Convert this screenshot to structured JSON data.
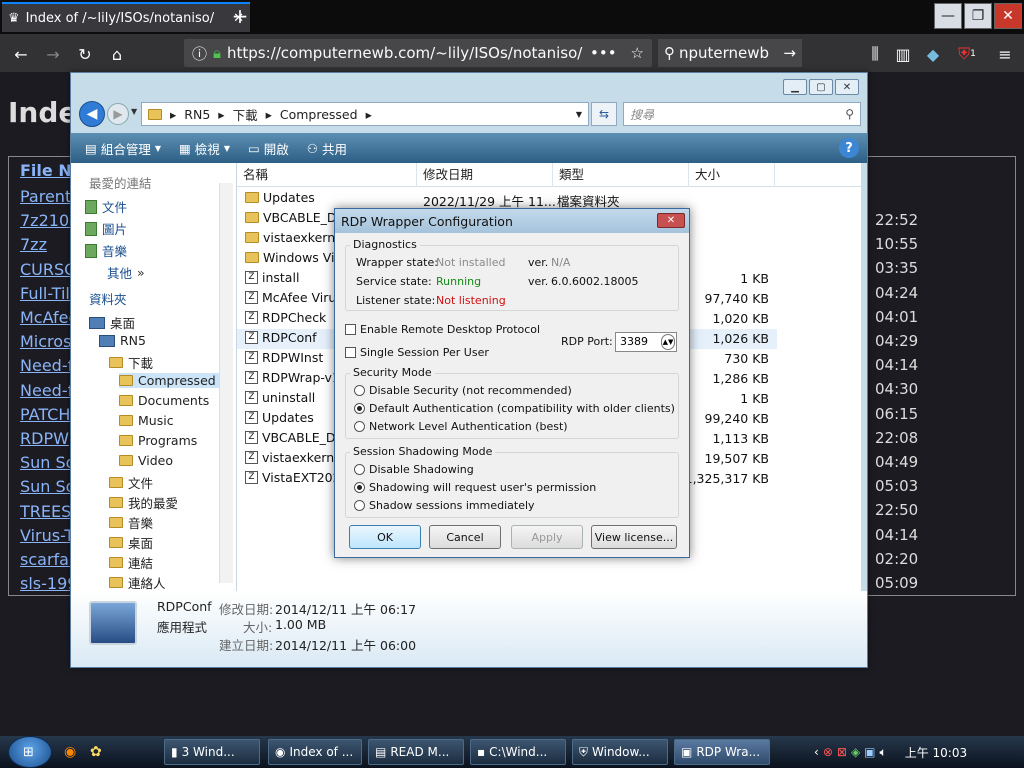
{
  "browser": {
    "tab_title": "Index of /~lily/ISOs/notaniso/",
    "url": "https://computernewb.com/~lily/ISOs/notaniso/",
    "search_text": "nputernewb",
    "new_tab": "+",
    "badge_count": "1"
  },
  "page": {
    "heading": "Index",
    "header_col": "File Na",
    "links": [
      "Parent",
      "7z2104",
      "7zz",
      "CURSO",
      "Full-Tilt",
      "McAfee",
      "Microso",
      "Need-fo",
      "Need-fo",
      "PATCH",
      "RDPW",
      "Sun So",
      "Sun So",
      "TREES",
      "Virus-T",
      "scarfac",
      "sls-199"
    ],
    "times": [
      "22:52",
      "10:55",
      "03:35",
      "04:24",
      "04:01",
      "04:29",
      "04:14",
      "04:30",
      "06:15",
      "22:08",
      "04:49",
      "05:03",
      "22:50",
      "04:14",
      "02:20",
      "05:09"
    ]
  },
  "explorer": {
    "path": [
      "RN5",
      "下載",
      "Compressed"
    ],
    "search_placeholder": "搜尋",
    "toolbar": {
      "organize": "組合管理",
      "view": "檢視",
      "open": "開啟",
      "share": "共用"
    },
    "nav": {
      "favorites_header": "最愛的連結",
      "favorites": [
        "文件",
        "圖片",
        "音樂"
      ],
      "more": "其他",
      "folders_header": "資料夾",
      "tree": [
        "桌面",
        "RN5",
        "下載",
        "Compressed",
        "Documents",
        "Music",
        "Programs",
        "Video",
        "文件",
        "我的最愛",
        "音樂",
        "桌面",
        "連結",
        "連絡人"
      ]
    },
    "columns": {
      "name": "名稱",
      "date": "修改日期",
      "type": "類型",
      "size": "大小"
    },
    "rows": [
      {
        "name": "Updates",
        "date": "2022/11/29 上午 11...",
        "type": "檔案資料夾",
        "size": ""
      },
      {
        "name": "VBCABLE_Dri",
        "date": "",
        "type": "",
        "size": ""
      },
      {
        "name": "vistaexkernse",
        "date": "",
        "type": "",
        "size": ""
      },
      {
        "name": "Windows Vis",
        "date": "",
        "type": "",
        "size": ""
      },
      {
        "name": "install",
        "date": "",
        "type": "",
        "size": "1 KB"
      },
      {
        "name": "McAfee Virus",
        "date": "",
        "type": "",
        "size": "97,740 KB"
      },
      {
        "name": "RDPCheck",
        "date": "",
        "type": "",
        "size": "1,020 KB"
      },
      {
        "name": "RDPConf",
        "date": "",
        "type": "",
        "size": "1,026 KB"
      },
      {
        "name": "RDPWInst",
        "date": "",
        "type": "",
        "size": "730 KB"
      },
      {
        "name": "RDPWrap-v1",
        "date": "",
        "type": "",
        "size": "1,286 KB"
      },
      {
        "name": "uninstall",
        "date": "",
        "type": "",
        "size": "1 KB"
      },
      {
        "name": "Updates",
        "date": "",
        "type": "",
        "size": "99,240 KB"
      },
      {
        "name": "VBCABLE_Dri",
        "date": "",
        "type": "",
        "size": "1,113 KB"
      },
      {
        "name": "vistaexkernse",
        "date": "",
        "type": "",
        "size": "19,507 KB"
      },
      {
        "name": "VistaEXT202",
        "date": "",
        "type": "",
        "size": "1,325,317 KB"
      }
    ],
    "status": {
      "name": "RDPConf",
      "kind": "應用程式",
      "modified_label": "修改日期:",
      "modified": "2014/12/11 上午 06:17",
      "size_label": "大小:",
      "size": "1.00 MB",
      "created_label": "建立日期:",
      "created": "2014/12/11 上午 06:00"
    }
  },
  "dialog": {
    "title": "RDP Wrapper Configuration",
    "diagnostics_label": "Diagnostics",
    "wrapper_label": "Wrapper state:",
    "wrapper_value": "Not installed",
    "ver_label1": "ver.",
    "ver_value1": "N/A",
    "service_label": "Service state:",
    "service_value": "Running",
    "ver_label2": "ver.",
    "ver_value2": "6.0.6002.18005",
    "listener_label": "Listener state:",
    "listener_value": "Not listening",
    "enable_rdp": "Enable Remote Desktop Protocol",
    "single_session": "Single Session Per User",
    "port_label": "RDP Port:",
    "port_value": "3389",
    "security_label": "Security Mode",
    "sec_opts": [
      "Disable Security (not recommended)",
      "Default Authentication (compatibility with older clients)",
      "Network Level Authentication (best)"
    ],
    "shadow_label": "Session Shadowing Mode",
    "shadow_opts": [
      "Disable Shadowing",
      "Shadowing will request user's permission",
      "Shadow sessions immediately"
    ],
    "ok": "OK",
    "cancel": "Cancel",
    "apply": "Apply",
    "license": "View license...",
    "colors": {
      "not_installed": "#8a8a8a",
      "running": "#128a12",
      "not_listening": "#d01010"
    }
  },
  "taskbar": {
    "tasks": [
      "3 Wind...",
      "Index of ...",
      "READ M...",
      "C:\\Wind...",
      "Window...",
      "RDP Wra..."
    ],
    "clock": "上午 10:03"
  }
}
